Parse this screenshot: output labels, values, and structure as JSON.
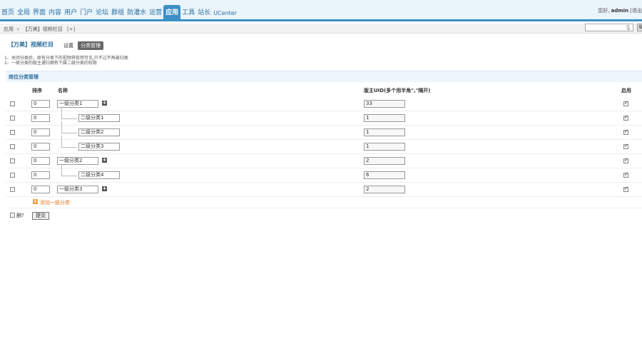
{
  "nav": {
    "items": [
      {
        "label": "首页",
        "active": false
      },
      {
        "label": "全局",
        "active": false
      },
      {
        "label": "界面",
        "active": false
      },
      {
        "label": "内容",
        "active": false
      },
      {
        "label": "用户",
        "active": false
      },
      {
        "label": "门户",
        "active": false
      },
      {
        "label": "论坛",
        "active": false
      },
      {
        "label": "群组",
        "active": false
      },
      {
        "label": "防灌水",
        "active": false
      },
      {
        "label": "运营",
        "active": false
      },
      {
        "label": "应用",
        "active": true
      },
      {
        "label": "工具",
        "active": false
      },
      {
        "label": "站长",
        "active": false
      },
      {
        "label": "UCenter",
        "active": false
      }
    ]
  },
  "user": {
    "greeting": "您好,",
    "name": "admin",
    "logout": "[退出"
  },
  "breadcrumb": {
    "root": "应用",
    "sep": "»",
    "current": "【万美】视频栏目",
    "add": "[+]"
  },
  "search": {
    "button": "搜"
  },
  "page": {
    "title": "【万美】视频栏目",
    "tab_settings": "设置",
    "tab_manage": "分类管理"
  },
  "tips": [
    "1、关闭分类后，原有分类下的视频将依然可见,只不过不再被归类",
    "2、一级分类的版主通归拥有下属二级分类的权限"
  ],
  "section": {
    "title": "岗位分类管理"
  },
  "columns": {
    "order": "排序",
    "name": "名称",
    "moderator": "版主UID(多个用半角\",\"隔开)",
    "enabled": "启用"
  },
  "rows": [
    {
      "order": "0",
      "name": "一级分类1",
      "level": 1,
      "uid": "33",
      "enabled": true,
      "has_add": true
    },
    {
      "order": "0",
      "name": "二级分类1",
      "level": 2,
      "uid": "1",
      "enabled": true,
      "has_add": false
    },
    {
      "order": "0",
      "name": "二级分类2",
      "level": 2,
      "uid": "1",
      "enabled": true,
      "has_add": false
    },
    {
      "order": "0",
      "name": "二级分类3",
      "level": 2,
      "uid": "1",
      "enabled": true,
      "has_add": false
    },
    {
      "order": "0",
      "name": "一级分类2",
      "level": 1,
      "uid": "2",
      "enabled": true,
      "has_add": true
    },
    {
      "order": "0",
      "name": "二级分类4",
      "level": 2,
      "uid": "6",
      "enabled": true,
      "has_add": false
    },
    {
      "order": "0",
      "name": "一级分类3",
      "level": 1,
      "uid": "2",
      "enabled": true,
      "has_add": true
    }
  ],
  "add_category": "添加一级分类",
  "footer": {
    "delete_label": "删?",
    "submit": "提交"
  },
  "colors": {
    "accent": "#3b8fc6",
    "link": "#2b6fa0",
    "add": "#e8731f"
  }
}
